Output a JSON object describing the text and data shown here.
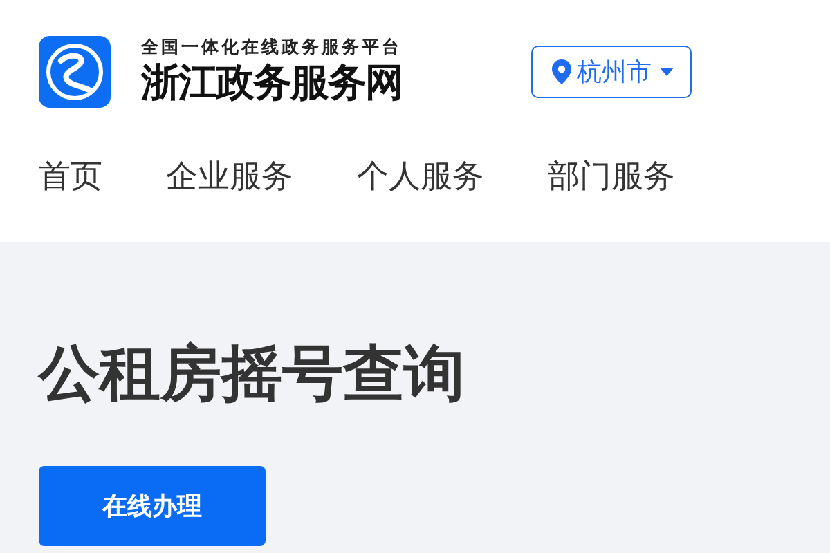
{
  "header": {
    "tagline": "全国一体化在线政务服务平台",
    "site_name": "浙江政务服务网",
    "location": "杭州市"
  },
  "nav": [
    {
      "label": "首页"
    },
    {
      "label": "企业服务"
    },
    {
      "label": "个人服务"
    },
    {
      "label": "部门服务"
    }
  ],
  "page": {
    "title": "公租房摇号查询",
    "action": "在线办理"
  }
}
